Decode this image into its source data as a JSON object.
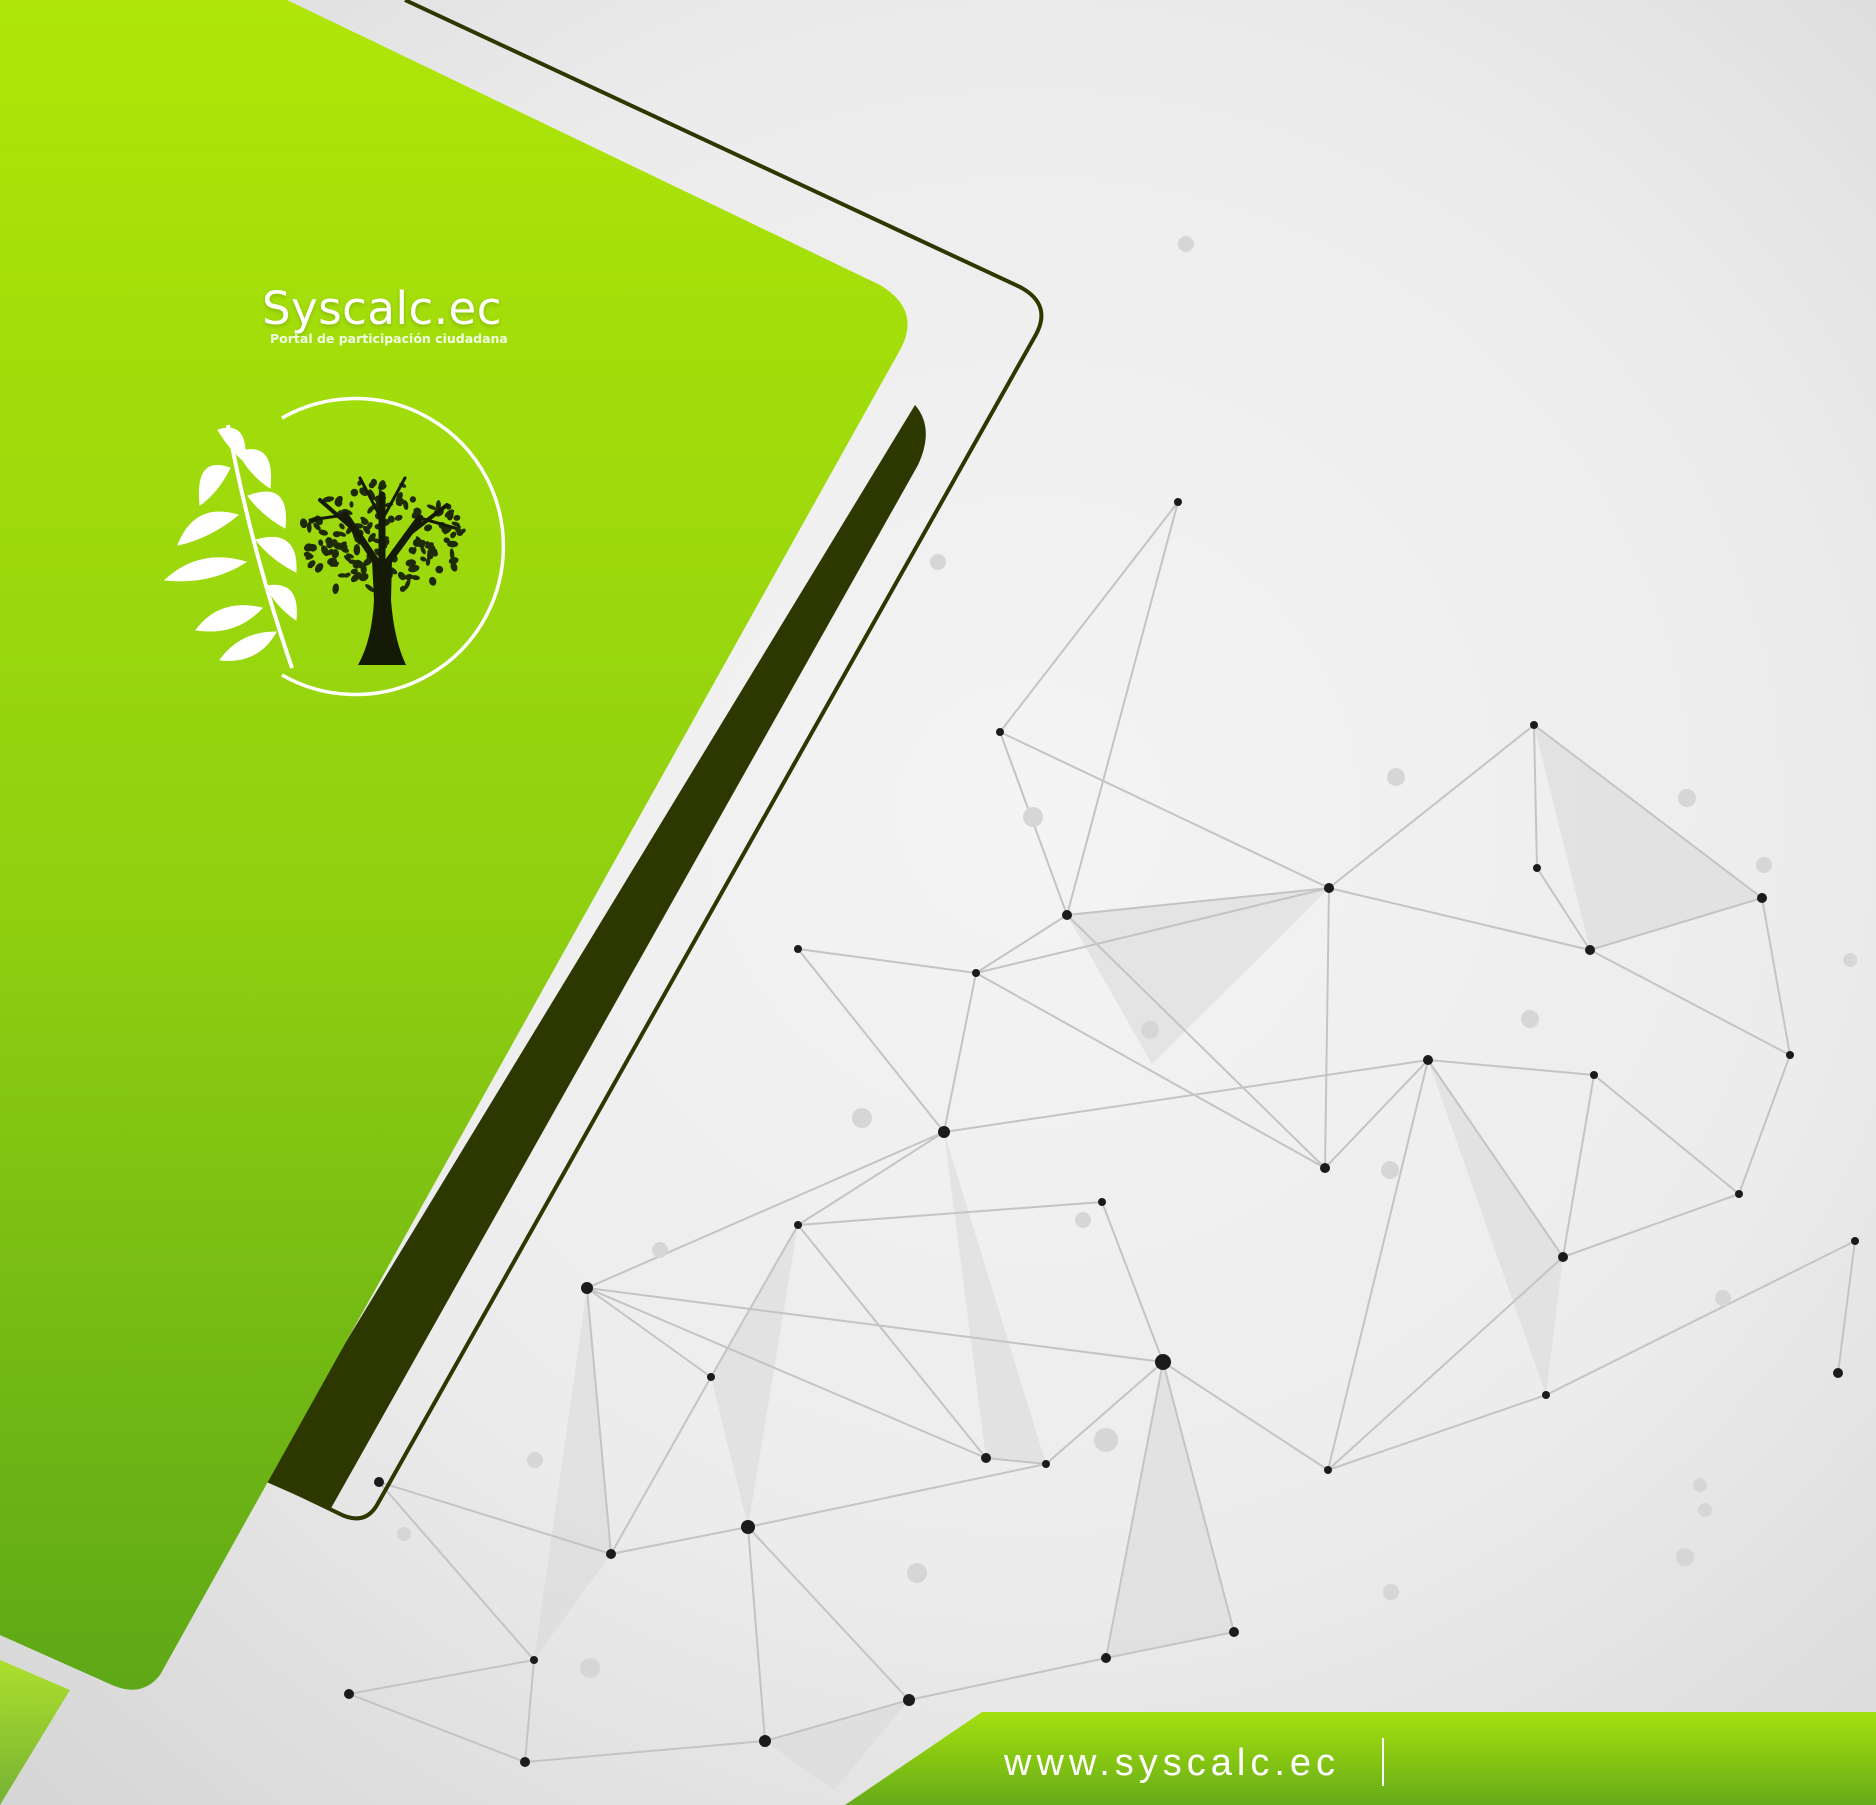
{
  "brand": {
    "name": "Syscalc.ec",
    "tagline": "Portal de participación ciudadana"
  },
  "footer": {
    "url": "www.syscalc.ec"
  },
  "colors": {
    "lime_light": "#afe607",
    "lime_mid": "#8fcf10",
    "lime_dark": "#5aa515",
    "olive_dark": "#2c3800",
    "node_dark": "#1b1b1b",
    "background": "#ececec"
  },
  "icons": {
    "logo": "olive-branch-and-tree-icon",
    "background": "network-graph-icon"
  }
}
